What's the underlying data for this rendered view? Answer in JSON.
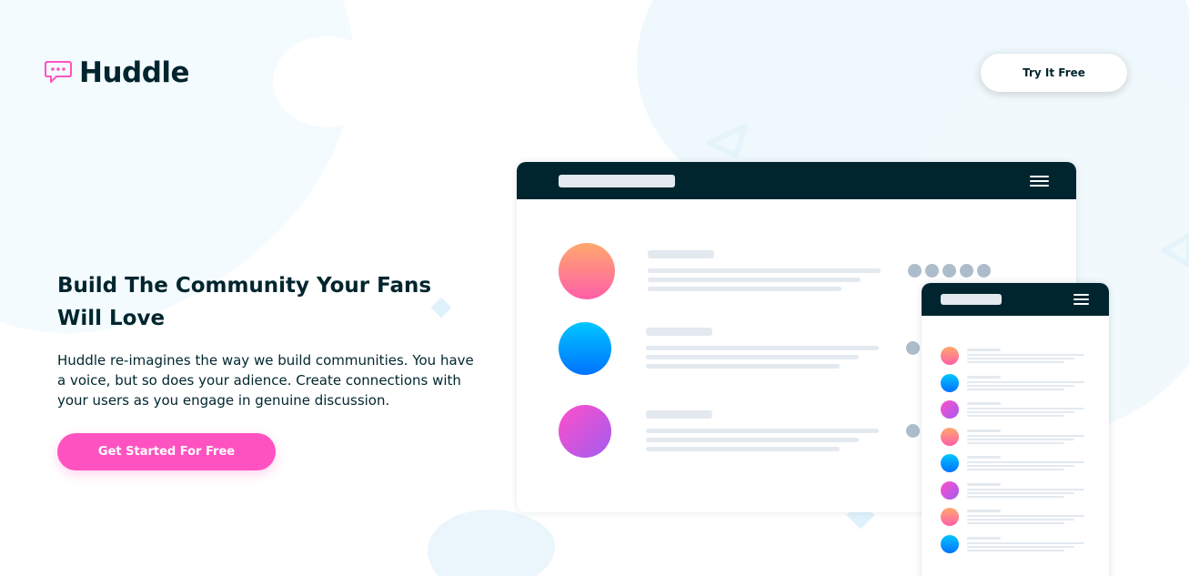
{
  "brand": {
    "name": "Huddle",
    "icon": "chat-bubble-icon",
    "accent": "#ff52c1",
    "dark": "#00252e"
  },
  "header": {
    "cta_label": "Try It Free"
  },
  "hero": {
    "title": "Build The Community Your Fans Will Love",
    "body": "Huddle re-imagines the way we build communities. You have a voice, but so does your adience. Create connections with your users as you engage in genuine discussion.",
    "cta_label": "Get Started For Free"
  },
  "illustration": {
    "avatar_gradients": [
      "orange-pink",
      "blue",
      "pink-purple"
    ],
    "colors": {
      "orange": "#ffa86d",
      "pink": "#ff5fa8",
      "blue_light": "#00c6ff",
      "blue_dark": "#0072ff",
      "magenta": "#ff4fc9",
      "purple": "#a25cf0"
    }
  }
}
